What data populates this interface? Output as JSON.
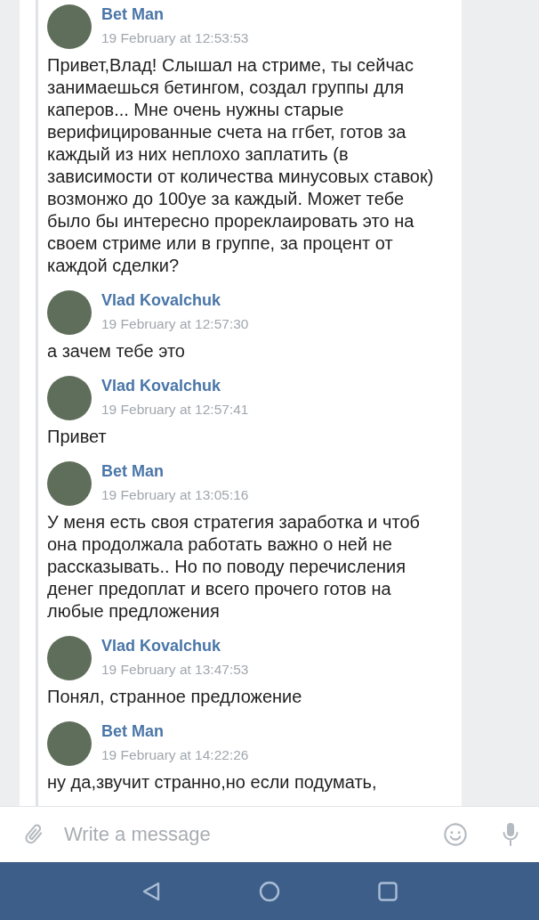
{
  "messages": [
    {
      "author": "Bet Man",
      "time": "19 February at 12:53:53",
      "text": "Привет,Влад! Слышал на стриме, ты сейчас занимаешься бетингом, создал группы для каперов... Мне очень нужны старые верифицированные счета на ггбет, готов за каждый из них неплохо заплатить (в зависимости от количества минусовых ставок) возмонжо до 100уе за каждый. Может тебе было бы интересно прореклаировать это на своем стриме или в группе, за процент от каждой сделки?"
    },
    {
      "author": "Vlad Kovalchuk",
      "time": "19 February at 12:57:30",
      "text": "а зачем тебе это"
    },
    {
      "author": "Vlad Kovalchuk",
      "time": "19 February at 12:57:41",
      "text": "Привет"
    },
    {
      "author": "Bet Man",
      "time": "19 February at 13:05:16",
      "text": "У меня есть своя стратегия заработка и чтоб она продолжала работать важно о ней не рассказывать.. Но по поводу перечисления денег предоплат и всего прочего готов на любые предложения"
    },
    {
      "author": "Vlad Kovalchuk",
      "time": "19 February at 13:47:53",
      "text": "Понял, странное предложение"
    },
    {
      "author": "Bet Man",
      "time": "19 February at 14:22:26",
      "text": "ну да,звучит странно,но если подумать,"
    }
  ],
  "composer": {
    "placeholder": "Write a message"
  }
}
